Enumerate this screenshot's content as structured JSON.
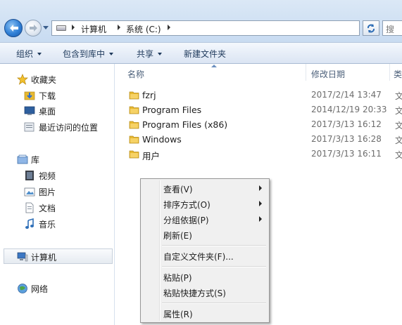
{
  "address_bar": {
    "segments": [
      "计算机",
      "系统 (C:)"
    ],
    "search_placeholder": "搜"
  },
  "toolbar": {
    "organize": "组织",
    "include_in_library": "包含到库中",
    "share": "共享",
    "new_folder": "新建文件夹"
  },
  "nav": {
    "favorites": "收藏夹",
    "downloads": "下载",
    "desktop": "桌面",
    "recent_places": "最近访问的位置",
    "libraries": "库",
    "videos": "视频",
    "pictures": "图片",
    "documents": "文档",
    "music": "音乐",
    "computer": "计算机",
    "network": "网络"
  },
  "columns": {
    "name": "名称",
    "date_modified": "修改日期",
    "type": "类"
  },
  "files": [
    {
      "name": "fzrj",
      "date": "2017/2/14 13:47",
      "type": "文"
    },
    {
      "name": "Program Files",
      "date": "2014/12/19 20:33",
      "type": "文"
    },
    {
      "name": "Program Files (x86)",
      "date": "2017/3/13 16:12",
      "type": "文"
    },
    {
      "name": "Windows",
      "date": "2017/3/13 16:28",
      "type": "文"
    },
    {
      "name": "用户",
      "date": "2017/3/13 16:11",
      "type": "文"
    }
  ],
  "context_menu": {
    "view": "查看(V)",
    "sort_by": "排序方式(O)",
    "group_by": "分组依据(P)",
    "refresh": "刷新(E)",
    "customize_folder": "自定义文件夹(F)...",
    "paste": "粘贴(P)",
    "paste_shortcut": "粘贴快捷方式(S)",
    "properties": "属性(R)"
  },
  "colors": {
    "folder": "#e8b930",
    "toolbar_text": "#1e395b",
    "back_button": "#2f7fd6"
  }
}
